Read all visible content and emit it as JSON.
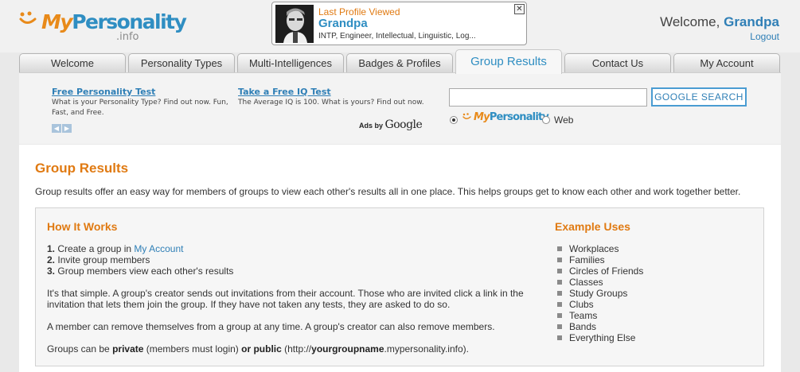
{
  "logo": {
    "my": "My",
    "personality": "Personality",
    "sub": ".info"
  },
  "last_profile": {
    "title": "Last Profile Viewed",
    "name": "Grandpa",
    "types": "INTP, Engineer, Intellectual, Linguistic, Log...",
    "close_glyph": "✕"
  },
  "user": {
    "welcome": "Welcome,",
    "name": "Grandpa",
    "logout": "Logout"
  },
  "tabs": [
    {
      "label": "Welcome",
      "active": false
    },
    {
      "label": "Personality Types",
      "active": false
    },
    {
      "label": "Multi-Intelligences",
      "active": false
    },
    {
      "label": "Badges & Profiles",
      "active": false
    },
    {
      "label": "Group Results",
      "active": true
    },
    {
      "label": "Contact Us",
      "active": false
    },
    {
      "label": "My Account",
      "active": false
    }
  ],
  "ads": [
    {
      "link": "Free Personality Test",
      "text": "What is your Personality Type? Find out now. Fun, Fast, and Free."
    },
    {
      "link": "Take a Free IQ Test",
      "text": "The Average IQ is 100. What is yours? Find out now."
    }
  ],
  "ads_by": {
    "prefix": "Ads by",
    "brand": "Google"
  },
  "search": {
    "value": "",
    "button": "GOOGLE SEARCH",
    "options": [
      {
        "label": "MyPersonality",
        "selected": true
      },
      {
        "label": "Web",
        "selected": false
      }
    ]
  },
  "page": {
    "title": "Group Results",
    "intro": "Group results offer an easy way for members of groups to view each other's results all in one place. This helps groups get to know each other and work together better."
  },
  "how_it_works": {
    "heading": "How It Works",
    "steps": [
      {
        "num": "1.",
        "text": "Create a group in ",
        "link": "My Account"
      },
      {
        "num": "2.",
        "text": "Invite group members"
      },
      {
        "num": "3.",
        "text": "Group members view each other's results"
      }
    ],
    "para1": "It's that simple. A group's creator sends out invitations from their account. Those who are invited click a link in the invitation that lets them join the group. If they have not taken any tests, they are asked to do so.",
    "para2": "A member can remove themselves from a group at any time. A group's creator can also remove members.",
    "para3": {
      "a": "Groups can be ",
      "b": "private",
      "c": " (members must login) ",
      "d": "or public",
      "e": " (http://",
      "f": "yourgroupname",
      "g": ".mypersonality.info)."
    }
  },
  "example_uses": {
    "heading": "Example Uses",
    "items": [
      "Workplaces",
      "Families",
      "Circles of Friends",
      "Classes",
      "Study Groups",
      "Clubs",
      "Teams",
      "Bands",
      "Everything Else"
    ]
  },
  "colors": {
    "accent_orange": "#e07a12",
    "brand_blue": "#2f8ec2",
    "link_blue": "#2f7fb6"
  }
}
